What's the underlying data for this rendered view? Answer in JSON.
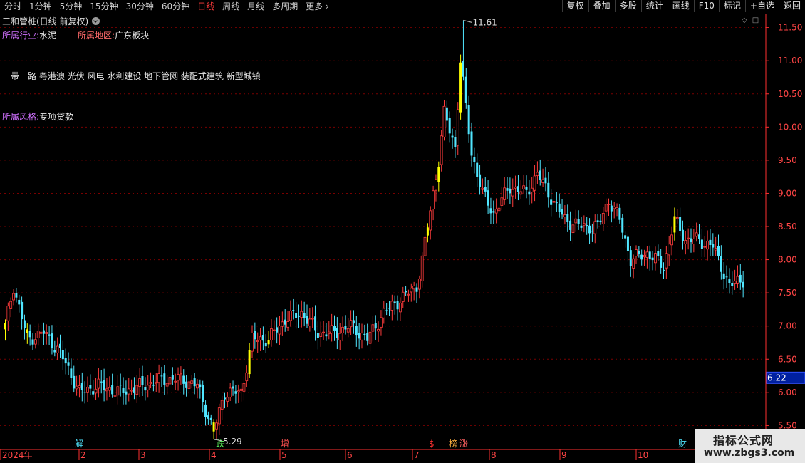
{
  "periods": [
    "分时",
    "1分钟",
    "5分钟",
    "15分钟",
    "30分钟",
    "60分钟",
    "日线",
    "周线",
    "月线",
    "多周期",
    "更多"
  ],
  "active_period": "日线",
  "tools": [
    "复权",
    "叠加",
    "多股",
    "统计",
    "画线",
    "F10",
    "标记",
    "+自选",
    "返回"
  ],
  "title": "三和管桩(日线 前复权)",
  "info": {
    "industry_label": "所属行业",
    "industry_value": "水泥",
    "region_label": "所属地区",
    "region_value": "广东板块",
    "concepts": "一带一路 粤港澳 光伏 风电 水利建设 地下管网 装配式建筑 新型城镇",
    "style_label": "所属风格",
    "style_value": "专项贷款"
  },
  "annotations": {
    "high": "11.61",
    "low": "5.29"
  },
  "event_labels": [
    "解",
    "跌",
    "增",
    "$",
    "榜",
    "涨",
    "财"
  ],
  "watermark": {
    "line1": "指标公式网",
    "line2": "www.zbgs3.com"
  },
  "colors": {
    "up": "#ff3c3c",
    "down": "#50e6ff",
    "limit": "#ffff00",
    "grid": "#7a0000",
    "axis": "#ff2f2f"
  },
  "chart_data": {
    "type": "candlestick",
    "y_ticks": [
      "11.50",
      "11.00",
      "10.50",
      "10.00",
      "9.50",
      "9.00",
      "8.50",
      "8.00",
      "7.50",
      "7.00",
      "6.50",
      "6.00",
      "5.50"
    ],
    "ylim": [
      5.3,
      11.7
    ],
    "x_ticks": [
      "2024年",
      "2",
      "3",
      "4",
      "5",
      "6",
      "7",
      "8",
      "9",
      "10"
    ],
    "current_price": "6.22",
    "high": 11.61,
    "low": 5.29,
    "close_path": [
      {
        "i": 0,
        "c": 7.0
      },
      {
        "i": 3,
        "c": 7.6
      },
      {
        "i": 8,
        "c": 6.8
      },
      {
        "i": 14,
        "c": 6.9
      },
      {
        "i": 20,
        "c": 6.6
      },
      {
        "i": 27,
        "c": 6.0
      },
      {
        "i": 34,
        "c": 6.1
      },
      {
        "i": 42,
        "c": 6.0
      },
      {
        "i": 50,
        "c": 6.1
      },
      {
        "i": 58,
        "c": 6.2
      },
      {
        "i": 64,
        "c": 6.2
      },
      {
        "i": 70,
        "c": 6.1
      },
      {
        "i": 76,
        "c": 5.4
      },
      {
        "i": 80,
        "c": 6.0
      },
      {
        "i": 86,
        "c": 6.0
      },
      {
        "i": 90,
        "c": 6.8
      },
      {
        "i": 96,
        "c": 6.8
      },
      {
        "i": 102,
        "c": 7.1
      },
      {
        "i": 108,
        "c": 7.2
      },
      {
        "i": 114,
        "c": 6.9
      },
      {
        "i": 120,
        "c": 6.9
      },
      {
        "i": 126,
        "c": 7.0
      },
      {
        "i": 132,
        "c": 6.8
      },
      {
        "i": 138,
        "c": 7.2
      },
      {
        "i": 144,
        "c": 7.4
      },
      {
        "i": 150,
        "c": 7.6
      },
      {
        "i": 152,
        "c": 8.0
      },
      {
        "i": 154,
        "c": 8.5
      },
      {
        "i": 158,
        "c": 9.5
      },
      {
        "i": 160,
        "c": 10.2
      },
      {
        "i": 164,
        "c": 9.7
      },
      {
        "i": 166,
        "c": 11.0
      },
      {
        "i": 170,
        "c": 9.6
      },
      {
        "i": 174,
        "c": 9.0
      },
      {
        "i": 178,
        "c": 8.7
      },
      {
        "i": 184,
        "c": 9.1
      },
      {
        "i": 190,
        "c": 9.0
      },
      {
        "i": 194,
        "c": 9.3
      },
      {
        "i": 198,
        "c": 9.0
      },
      {
        "i": 204,
        "c": 8.6
      },
      {
        "i": 210,
        "c": 8.5
      },
      {
        "i": 216,
        "c": 8.5
      },
      {
        "i": 220,
        "c": 8.9
      },
      {
        "i": 224,
        "c": 8.6
      },
      {
        "i": 228,
        "c": 8.0
      },
      {
        "i": 234,
        "c": 8.1
      },
      {
        "i": 240,
        "c": 7.9
      },
      {
        "i": 244,
        "c": 8.6
      },
      {
        "i": 248,
        "c": 8.3
      },
      {
        "i": 252,
        "c": 8.3
      },
      {
        "i": 258,
        "c": 8.2
      },
      {
        "i": 264,
        "c": 7.6
      },
      {
        "i": 268,
        "c": 7.7
      }
    ]
  }
}
